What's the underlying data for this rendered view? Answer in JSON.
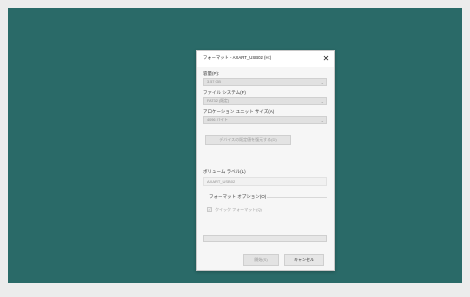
{
  "dialog": {
    "title": "フォーマット - AXART_USB02 (H:)",
    "close_glyph": "✕",
    "capacity_label": "容量(P):",
    "capacity_value": "3.57 GB",
    "filesystem_label": "ファイル システム(F)",
    "filesystem_value": "FAT32 (既定)",
    "allocation_label": "アロケーション ユニット サイズ(A)",
    "allocation_value": "4096 バイト",
    "restore_defaults_label": "デバイスの既定値を復元する(D)",
    "volume_label_label": "ボリューム ラベル(L)",
    "volume_label_value": "AXART_USB02",
    "format_options_label": "フォーマット オプション(O)",
    "quick_format_label": "クイック フォーマット(Q)",
    "quick_format_checked": true,
    "check_glyph": "✓",
    "progress_value": 0,
    "start_label": "開始(S)",
    "cancel_label": "キャンセル"
  },
  "icons": {
    "close": "close-icon",
    "chevron": "chevron-down-icon",
    "check": "check-icon"
  },
  "colors": {
    "desktop": "#2a6a68",
    "dialog_bg": "#f6f6f6",
    "disabled_text": "#9a9a9a"
  }
}
